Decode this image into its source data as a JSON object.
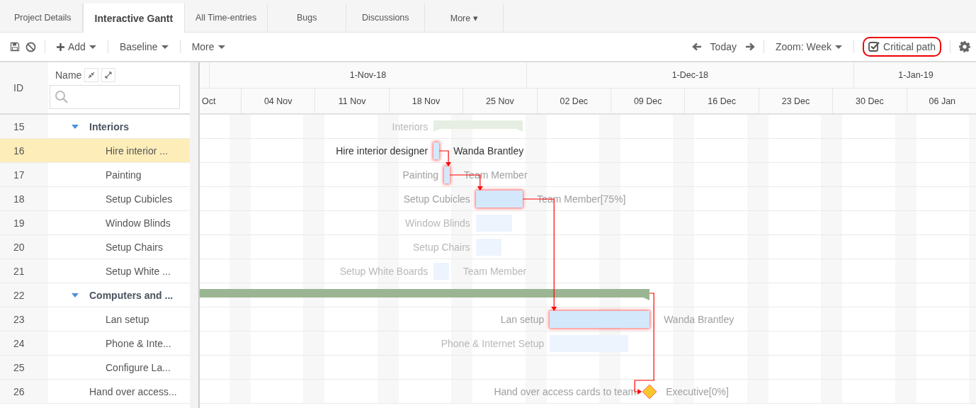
{
  "tabs": [
    {
      "label": "Project Details",
      "selected": false
    },
    {
      "label": "Interactive Gantt",
      "selected": true
    },
    {
      "label": "All Time-entries",
      "selected": false
    },
    {
      "label": "Bugs",
      "selected": false
    },
    {
      "label": "Discussions",
      "selected": false
    },
    {
      "label": "More ▾",
      "selected": false
    }
  ],
  "toolbar": {
    "add": "Add",
    "baseline": "Baseline",
    "more": "More",
    "today": "Today",
    "zoom": "Zoom: Week",
    "critical_path": {
      "label": "Critical path",
      "checked": true,
      "highlighted": true
    }
  },
  "grid_header": {
    "id": "ID",
    "name": "Name"
  },
  "timescale": {
    "months": [
      "1-Nov-18",
      "1-Dec-18",
      "1-Jan-19"
    ],
    "weeks": [
      "Oct",
      "04 Nov",
      "11 Nov",
      "18 Nov",
      "25 Nov",
      "02 Dec",
      "09 Dec",
      "16 Dec",
      "23 Dec",
      "30 Dec",
      "06 Jan"
    ]
  },
  "tasks": [
    {
      "number": "15",
      "name": "Interiors",
      "kind": "summary",
      "bar_label": "Interiors",
      "critical": false,
      "selected": false,
      "expanded": true,
      "children": [
        {
          "number": "16",
          "name": "Hire interior ...",
          "kind": "task",
          "bar_label": "Hire interior designer",
          "resource": "Wanda Brantley",
          "critical": true,
          "selected": true
        },
        {
          "number": "17",
          "name": "Painting",
          "kind": "task",
          "bar_label": "Painting",
          "resource": "Team Member",
          "critical": true,
          "selected": false
        },
        {
          "number": "18",
          "name": "Setup Cubicles",
          "kind": "task",
          "bar_label": "Setup Cubicles",
          "resource": "Team Member[75%]",
          "critical": true,
          "selected": false
        },
        {
          "number": "19",
          "name": "Window Blinds",
          "kind": "task",
          "bar_label": "Window Blinds",
          "critical": false,
          "selected": false
        },
        {
          "number": "20",
          "name": "Setup Chairs",
          "kind": "task",
          "bar_label": "Setup Chairs",
          "critical": false,
          "selected": false
        },
        {
          "number": "21",
          "name": "Setup White ...",
          "kind": "task",
          "bar_label": "Setup White Boards",
          "resource": "Team Member",
          "critical": false,
          "selected": false
        }
      ]
    },
    {
      "number": "22",
      "name": "Computers and ...",
      "kind": "summary",
      "critical": true,
      "selected": false,
      "expanded": true,
      "children": [
        {
          "number": "23",
          "name": "Lan setup",
          "kind": "task",
          "bar_label": "Lan setup",
          "resource": "Wanda Brantley",
          "critical": true,
          "selected": false
        },
        {
          "number": "24",
          "name": "Phone & Inte...",
          "kind": "task",
          "bar_label": "Phone & Internet Setup",
          "critical": false,
          "selected": false
        },
        {
          "number": "25",
          "name": "Configure La...",
          "selected": false
        }
      ]
    },
    {
      "number": "26",
      "name": "Hand over access...",
      "kind": "milestone",
      "bar_label": "Hand over access cards to team",
      "resource": "Executive[0%]",
      "critical": true,
      "selected": false
    }
  ]
}
